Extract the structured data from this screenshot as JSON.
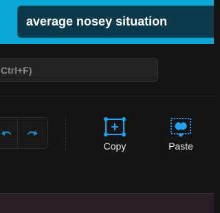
{
  "header": {
    "title": "average nosey situation",
    "accent_color": "#0aa6d6"
  },
  "search": {
    "placeholder": "Ctrl+F)"
  },
  "toolbar": {
    "undo_icon": "undo-icon",
    "redo_icon": "redo-icon",
    "copy_label": "Copy",
    "paste_label": "Paste",
    "copy_icon": "copy-selection-icon",
    "paste_icon": "paste-icon",
    "icon_color": "#1da1f2"
  }
}
